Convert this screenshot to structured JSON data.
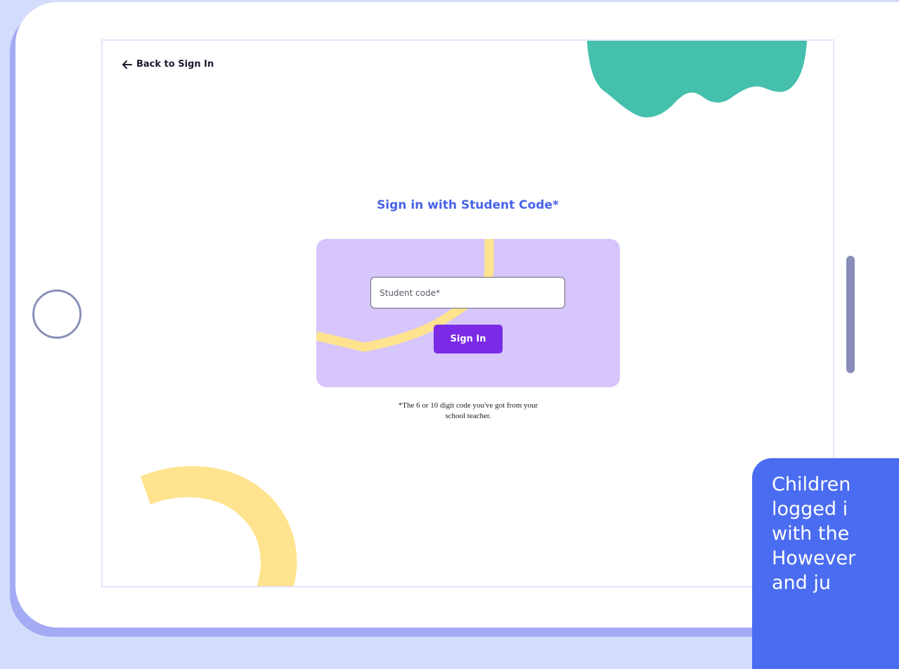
{
  "back_link": {
    "label": "Back to Sign In"
  },
  "title": "Sign in with Student Code*",
  "form": {
    "code_placeholder": "Student code*",
    "code_value": "",
    "submit_label": "Sign In"
  },
  "hint": {
    "line1": "*The 6 or 10 digit code you've got from your",
    "line2": "school teacher."
  },
  "callout": {
    "lines": [
      "Children",
      "logged i",
      "with the",
      "However",
      "and ju"
    ]
  },
  "colors": {
    "background": "#d4dcfb",
    "tablet_shadow": "#a4abf4",
    "title": "#4863e6",
    "card": "#d6c6fb",
    "button": "#7b2ae6",
    "blob": "#44c0ad",
    "accent_yellow": "#ffe38e",
    "callout": "#4a6cf0"
  },
  "icons": {
    "back": "arrow-left-icon"
  }
}
